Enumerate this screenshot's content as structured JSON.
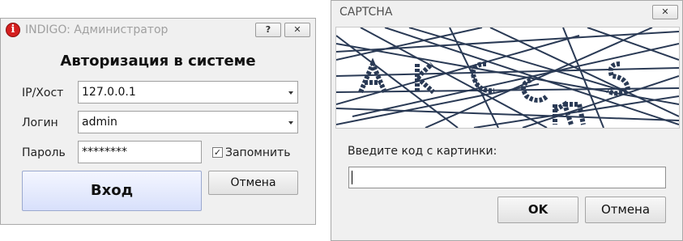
{
  "login_window": {
    "title": "INDIGO: Администратор",
    "help_button": "?",
    "close_button": "✕",
    "heading": "Авторизация в системе",
    "host_label": "IP/Хост",
    "host_value": "127.0.0.1",
    "login_label": "Логин",
    "login_value": "admin",
    "password_label": "Пароль",
    "password_value": "********",
    "remember_label": "Запомнить",
    "remember_checked": true,
    "remember_check_glyph": "✓",
    "login_button": "Вход",
    "cancel_button": "Отмена",
    "app_icon_glyph": "i"
  },
  "captcha_window": {
    "title": "CAPTCHA",
    "close_button": "✕",
    "prompt": "Введите код с картинки:",
    "code_value": "",
    "ok_button": "OK",
    "cancel_button": "Отмена"
  },
  "colors": {
    "captcha_ink": "#2a3a55",
    "app_icon": "#d41f1f",
    "primary_button": "#d8e0fb"
  }
}
